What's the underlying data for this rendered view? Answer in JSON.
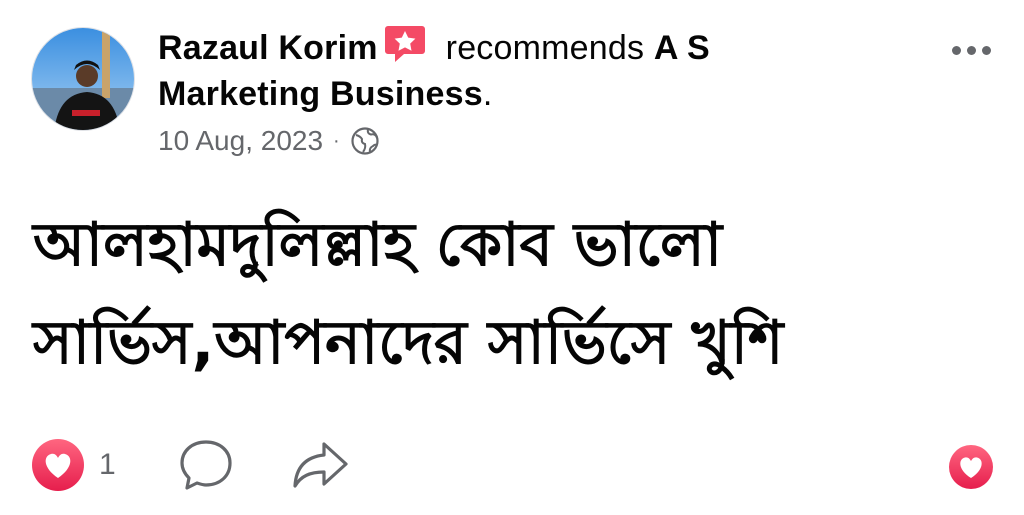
{
  "post": {
    "author_name": "Razaul Korim",
    "recommends_text": "recommends",
    "business_part1": "A S",
    "business_part2": "Marketing Business",
    "period": ".",
    "date": "10 Aug, 2023",
    "separator": "·",
    "privacy_icon": "globe-icon",
    "body_line1": "আলহামদুলিল্লাহ কোব ভালো",
    "body_line2": "সার্ভিস,আপনাদের সার্ভিসে খুশি",
    "reaction_count": "1"
  },
  "icons": {
    "more": "more-options-icon",
    "recommend": "recommend-star-icon",
    "reaction": "love-react-icon",
    "comment": "comment-icon",
    "share": "share-icon",
    "react_button": "love-react-button-icon"
  },
  "colors": {
    "recommend_badge": "#f44a65",
    "love": "#f33e58",
    "secondary_text": "#65676b",
    "text": "#050505"
  }
}
